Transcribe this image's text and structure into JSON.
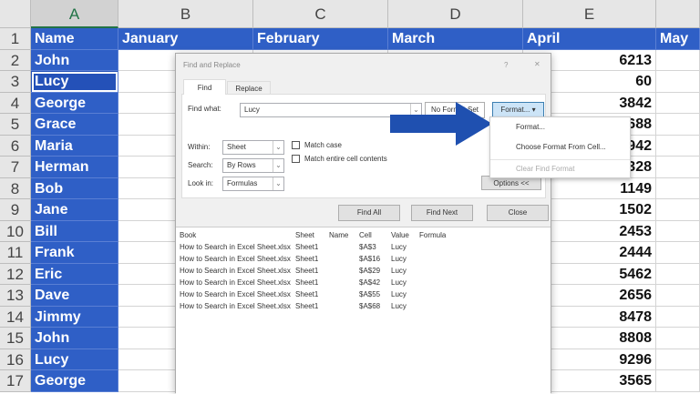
{
  "columns": [
    "A",
    "B",
    "C",
    "D",
    "E"
  ],
  "extra_column": "",
  "rows": [
    {
      "n": "1",
      "name": "Name",
      "b": "January",
      "c": "February",
      "d": "March",
      "e": "April",
      "f": "May"
    },
    {
      "n": "2",
      "name": "John",
      "e": "6213"
    },
    {
      "n": "3",
      "name": "Lucy",
      "e": "60"
    },
    {
      "n": "4",
      "name": "George",
      "e": "3842"
    },
    {
      "n": "5",
      "name": "Grace",
      "e": "688"
    },
    {
      "n": "6",
      "name": "Maria",
      "e": "942"
    },
    {
      "n": "7",
      "name": "Herman",
      "e": "328"
    },
    {
      "n": "8",
      "name": "Bob",
      "e": "1149"
    },
    {
      "n": "9",
      "name": "Jane",
      "e": "1502"
    },
    {
      "n": "10",
      "name": "Bill",
      "e": "2453"
    },
    {
      "n": "11",
      "name": "Frank",
      "e": "2444"
    },
    {
      "n": "12",
      "name": "Eric",
      "e": "5462"
    },
    {
      "n": "13",
      "name": "Dave",
      "e": "2656"
    },
    {
      "n": "14",
      "name": "Jimmy",
      "e": "8478"
    },
    {
      "n": "15",
      "name": "John",
      "e": "8808"
    },
    {
      "n": "16",
      "name": "Lucy",
      "e": "9296"
    },
    {
      "n": "17",
      "name": "George",
      "e": "3565"
    }
  ],
  "colors": {
    "highlight": "#2f5fc6",
    "arrow": "#1f50b0"
  },
  "dialog": {
    "title": "Find and Replace",
    "help": "?",
    "close": "✕",
    "tabs": [
      "Find",
      "Replace"
    ],
    "find_label": "Find what:",
    "find_value": "Lucy",
    "no_format": "No Format Set",
    "format_btn": "Format...",
    "within_label": "Within:",
    "within_value": "Sheet",
    "search_label": "Search:",
    "search_value": "By Rows",
    "lookin_label": "Look in:",
    "lookin_value": "Formulas",
    "match_case": "Match case",
    "match_entire": "Match entire cell contents",
    "options": "Options <<",
    "find_all": "Find All",
    "find_next": "Find Next",
    "close_btn": "Close",
    "headers": [
      "Book",
      "Sheet",
      "Name",
      "Cell",
      "Value",
      "Formula"
    ],
    "results": [
      [
        "How to Search in Excel Sheet.xlsx",
        "Sheet1",
        "",
        "$A$3",
        "Lucy",
        ""
      ],
      [
        "How to Search in Excel Sheet.xlsx",
        "Sheet1",
        "",
        "$A$16",
        "Lucy",
        ""
      ],
      [
        "How to Search in Excel Sheet.xlsx",
        "Sheet1",
        "",
        "$A$29",
        "Lucy",
        ""
      ],
      [
        "How to Search in Excel Sheet.xlsx",
        "Sheet1",
        "",
        "$A$42",
        "Lucy",
        ""
      ],
      [
        "How to Search in Excel Sheet.xlsx",
        "Sheet1",
        "",
        "$A$55",
        "Lucy",
        ""
      ],
      [
        "How to Search in Excel Sheet.xlsx",
        "Sheet1",
        "",
        "$A$68",
        "Lucy",
        ""
      ]
    ]
  },
  "format_menu": [
    "Format...",
    "Choose Format From Cell...",
    "Clear Find Format"
  ]
}
